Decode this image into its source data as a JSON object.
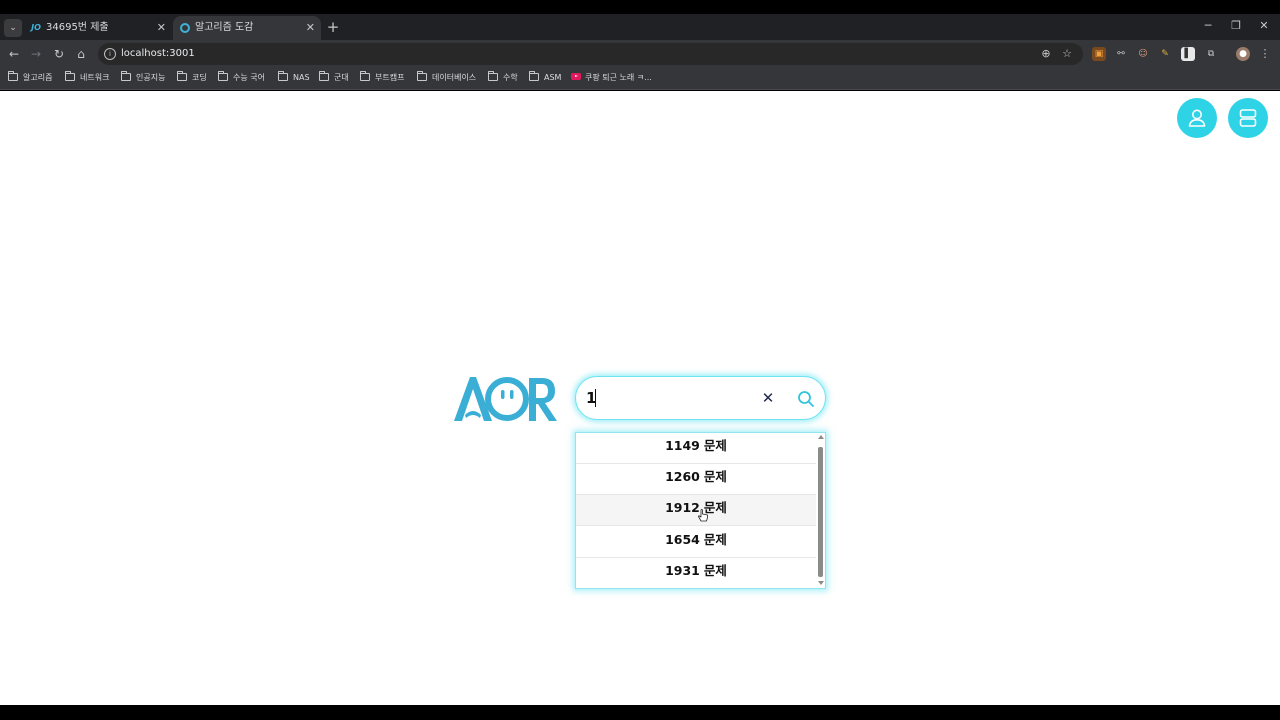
{
  "browser": {
    "tabs": [
      {
        "title": "34695번 제출",
        "favicon": "JO",
        "active": false
      },
      {
        "title": "알고리즘 도감",
        "favicon": "ring-icon",
        "active": true
      }
    ],
    "url": "localhost:3001",
    "bookmarks": [
      {
        "label": "알고리즘",
        "icon": "folder-icon"
      },
      {
        "label": "네트워크",
        "icon": "folder-icon"
      },
      {
        "label": "인공지능",
        "icon": "folder-icon"
      },
      {
        "label": "코딩",
        "icon": "folder-icon"
      },
      {
        "label": "수능 국어",
        "icon": "folder-icon"
      },
      {
        "label": "NAS",
        "icon": "folder-icon"
      },
      {
        "label": "군대",
        "icon": "folder-icon"
      },
      {
        "label": "부트캠프",
        "icon": "folder-icon"
      },
      {
        "label": "데이터베이스",
        "icon": "folder-icon"
      },
      {
        "label": "수학",
        "icon": "folder-icon"
      },
      {
        "label": "ASM",
        "icon": "folder-icon"
      },
      {
        "label": "쿠팡 퇴근 노래 ㅋ...",
        "icon": "youtube-icon"
      }
    ]
  },
  "app": {
    "logo_text": "AOR",
    "colors": {
      "accent": "#2ed3e6",
      "logo": "#3aaed4",
      "glow": "#4fe0f0"
    },
    "search": {
      "value": "1"
    },
    "suggestions": [
      {
        "number": "1149",
        "suffix": "문제"
      },
      {
        "number": "1260",
        "suffix": "문제"
      },
      {
        "number": "1912",
        "suffix": "문제"
      },
      {
        "number": "1654",
        "suffix": "문제"
      },
      {
        "number": "1931",
        "suffix": "문제"
      }
    ],
    "hovered_suggestion": "1912"
  }
}
